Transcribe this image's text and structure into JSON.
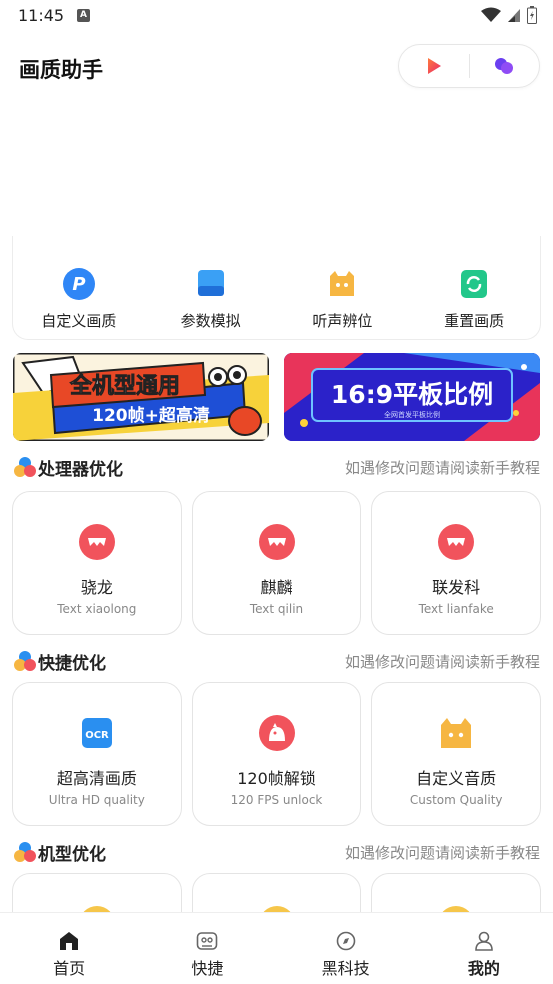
{
  "status_bar": {
    "time": "11:45",
    "notification_badge": "A"
  },
  "header": {
    "title": "画质助手"
  },
  "tools": [
    {
      "label": "自定义画质",
      "icon": "custom-quality-icon",
      "color": "#2f86f6"
    },
    {
      "label": "参数模拟",
      "icon": "parameter-sim-icon",
      "color": "#2a8ff0"
    },
    {
      "label": "听声辨位",
      "icon": "sound-locate-icon",
      "color": "#f6b642"
    },
    {
      "label": "重置画质",
      "icon": "reset-quality-icon",
      "color": "#22c78a"
    }
  ],
  "banners": {
    "left": {
      "line1": "全机型通用",
      "line2": "120帧+超高清"
    },
    "right": {
      "title": "16:9平板比例",
      "subtitle": "全网首发平板比例"
    }
  },
  "sections": [
    {
      "title": "处理器优化",
      "hint": "如遇修改问题请阅读新手教程",
      "items": [
        {
          "title": "骁龙",
          "subtitle": "Text xiaolong",
          "icon": "processor-icon"
        },
        {
          "title": "麒麟",
          "subtitle": "Text qilin",
          "icon": "processor-icon"
        },
        {
          "title": "联发科",
          "subtitle": "Text lianfake",
          "icon": "processor-icon"
        }
      ]
    },
    {
      "title": "快捷优化",
      "hint": "如遇修改问题请阅读新手教程",
      "items": [
        {
          "title": "超高清画质",
          "subtitle": "Ultra HD quality",
          "icon": "ocr-icon"
        },
        {
          "title": "120帧解锁",
          "subtitle": "120 FPS unlock",
          "icon": "chick-icon"
        },
        {
          "title": "自定义音质",
          "subtitle": "Custom Quality",
          "icon": "cat-face-icon"
        }
      ]
    },
    {
      "title": "机型优化",
      "hint": "如遇修改问题请阅读新手教程"
    }
  ],
  "tab_bar": [
    {
      "label": "首页",
      "icon": "home-icon"
    },
    {
      "label": "快捷",
      "icon": "gamepad-icon"
    },
    {
      "label": "黑科技",
      "icon": "compass-icon"
    },
    {
      "label": "我的",
      "icon": "user-icon",
      "active": true
    }
  ],
  "colors": {
    "accent_red": "#f1535c",
    "icon_yellow": "#f6b642",
    "banner_blue": "#2b22c9"
  }
}
